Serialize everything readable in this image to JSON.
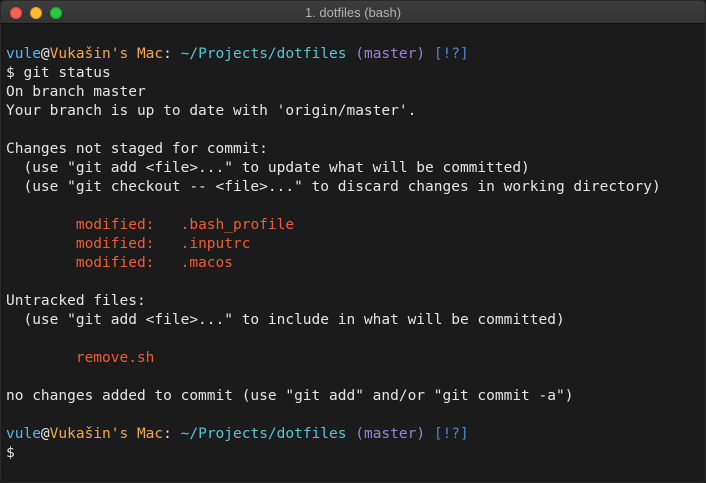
{
  "window": {
    "title": "1. dotfiles (bash)"
  },
  "prompt": {
    "user": "vule",
    "at": "@",
    "host": "Vukašin's Mac",
    "colon": ":",
    "path": "~/Projects/dotfiles",
    "branch": "(master)",
    "flags": "[!?]",
    "dollar": "$"
  },
  "command": "git status",
  "output": {
    "branch_line": "On branch master",
    "uptodate_line": "Your branch is up to date with 'origin/master'.",
    "not_staged_header": "Changes not staged for commit:",
    "hint_add": "  (use \"git add <file>...\" to update what will be committed)",
    "hint_checkout": "  (use \"git checkout -- <file>...\" to discard changes in working directory)",
    "modified": [
      {
        "status": "        modified:   ",
        "file": ".bash_profile"
      },
      {
        "status": "        modified:   ",
        "file": ".inputrc"
      },
      {
        "status": "        modified:   ",
        "file": ".macos"
      }
    ],
    "untracked_header": "Untracked files:",
    "hint_untracked": "  (use \"git add <file>...\" to include in what will be committed)",
    "untracked_indent": "        ",
    "untracked_file": "remove.sh",
    "summary": "no changes added to commit (use \"git add\" and/or \"git commit -a\")"
  },
  "colors": {
    "user": "#56b6f0",
    "host": "#f2a94d",
    "path": "#57c7d2",
    "branch": "#9b81d8",
    "flags": "#4f86d6",
    "modified": "#f25c32",
    "background": "#1b1b1b"
  }
}
